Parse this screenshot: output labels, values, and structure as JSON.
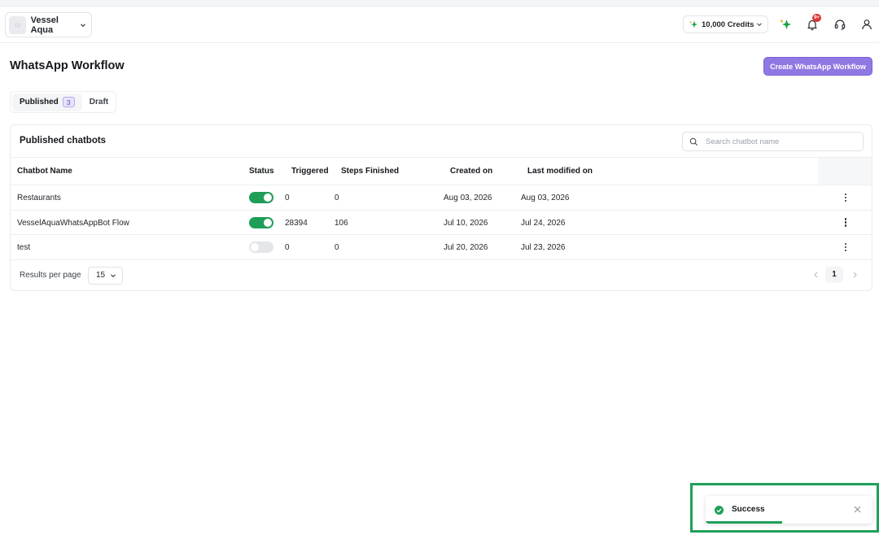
{
  "topbar": {
    "org_name": "Vessel Aqua",
    "credits_label": "10,000 Credits",
    "notification_badge": "9+",
    "icons": [
      "sparkle-icon",
      "bell-icon",
      "headset-icon",
      "user-icon"
    ]
  },
  "page": {
    "title": "WhatsApp Workflow",
    "create_button": "Create WhatsApp Workflow"
  },
  "tabs": [
    {
      "label": "Published",
      "count": "3",
      "active": true
    },
    {
      "label": "Draft",
      "active": false
    }
  ],
  "card": {
    "title": "Published chatbots",
    "search_placeholder": "Search chatbot name",
    "columns": [
      "Chatbot Name",
      "Status",
      "Triggered",
      "Steps Finished",
      "Created on",
      "Last modified on"
    ],
    "rows": [
      {
        "name": "Restaurants",
        "status": "on",
        "triggered": "0",
        "steps": "0",
        "created": "Aug 03, 2026",
        "modified": "Aug 03, 2026"
      },
      {
        "name": "VesselAquaWhatsAppBot Flow",
        "status": "on",
        "triggered": "28394",
        "steps": "106",
        "created": "Jul 10, 2026",
        "modified": "Jul 24, 2026"
      },
      {
        "name": "test",
        "status": "off",
        "triggered": "0",
        "steps": "0",
        "created": "Jul 20, 2026",
        "modified": "Jul 23, 2026"
      }
    ]
  },
  "footer": {
    "results_label": "Results per page",
    "per_page": "15",
    "current_page": "1"
  },
  "toast": {
    "message": "Success",
    "progress": 0.46,
    "color": "#1fa05a"
  },
  "colors": {
    "accent": "#8f78e2",
    "toggle_on": "#1e9e57"
  }
}
